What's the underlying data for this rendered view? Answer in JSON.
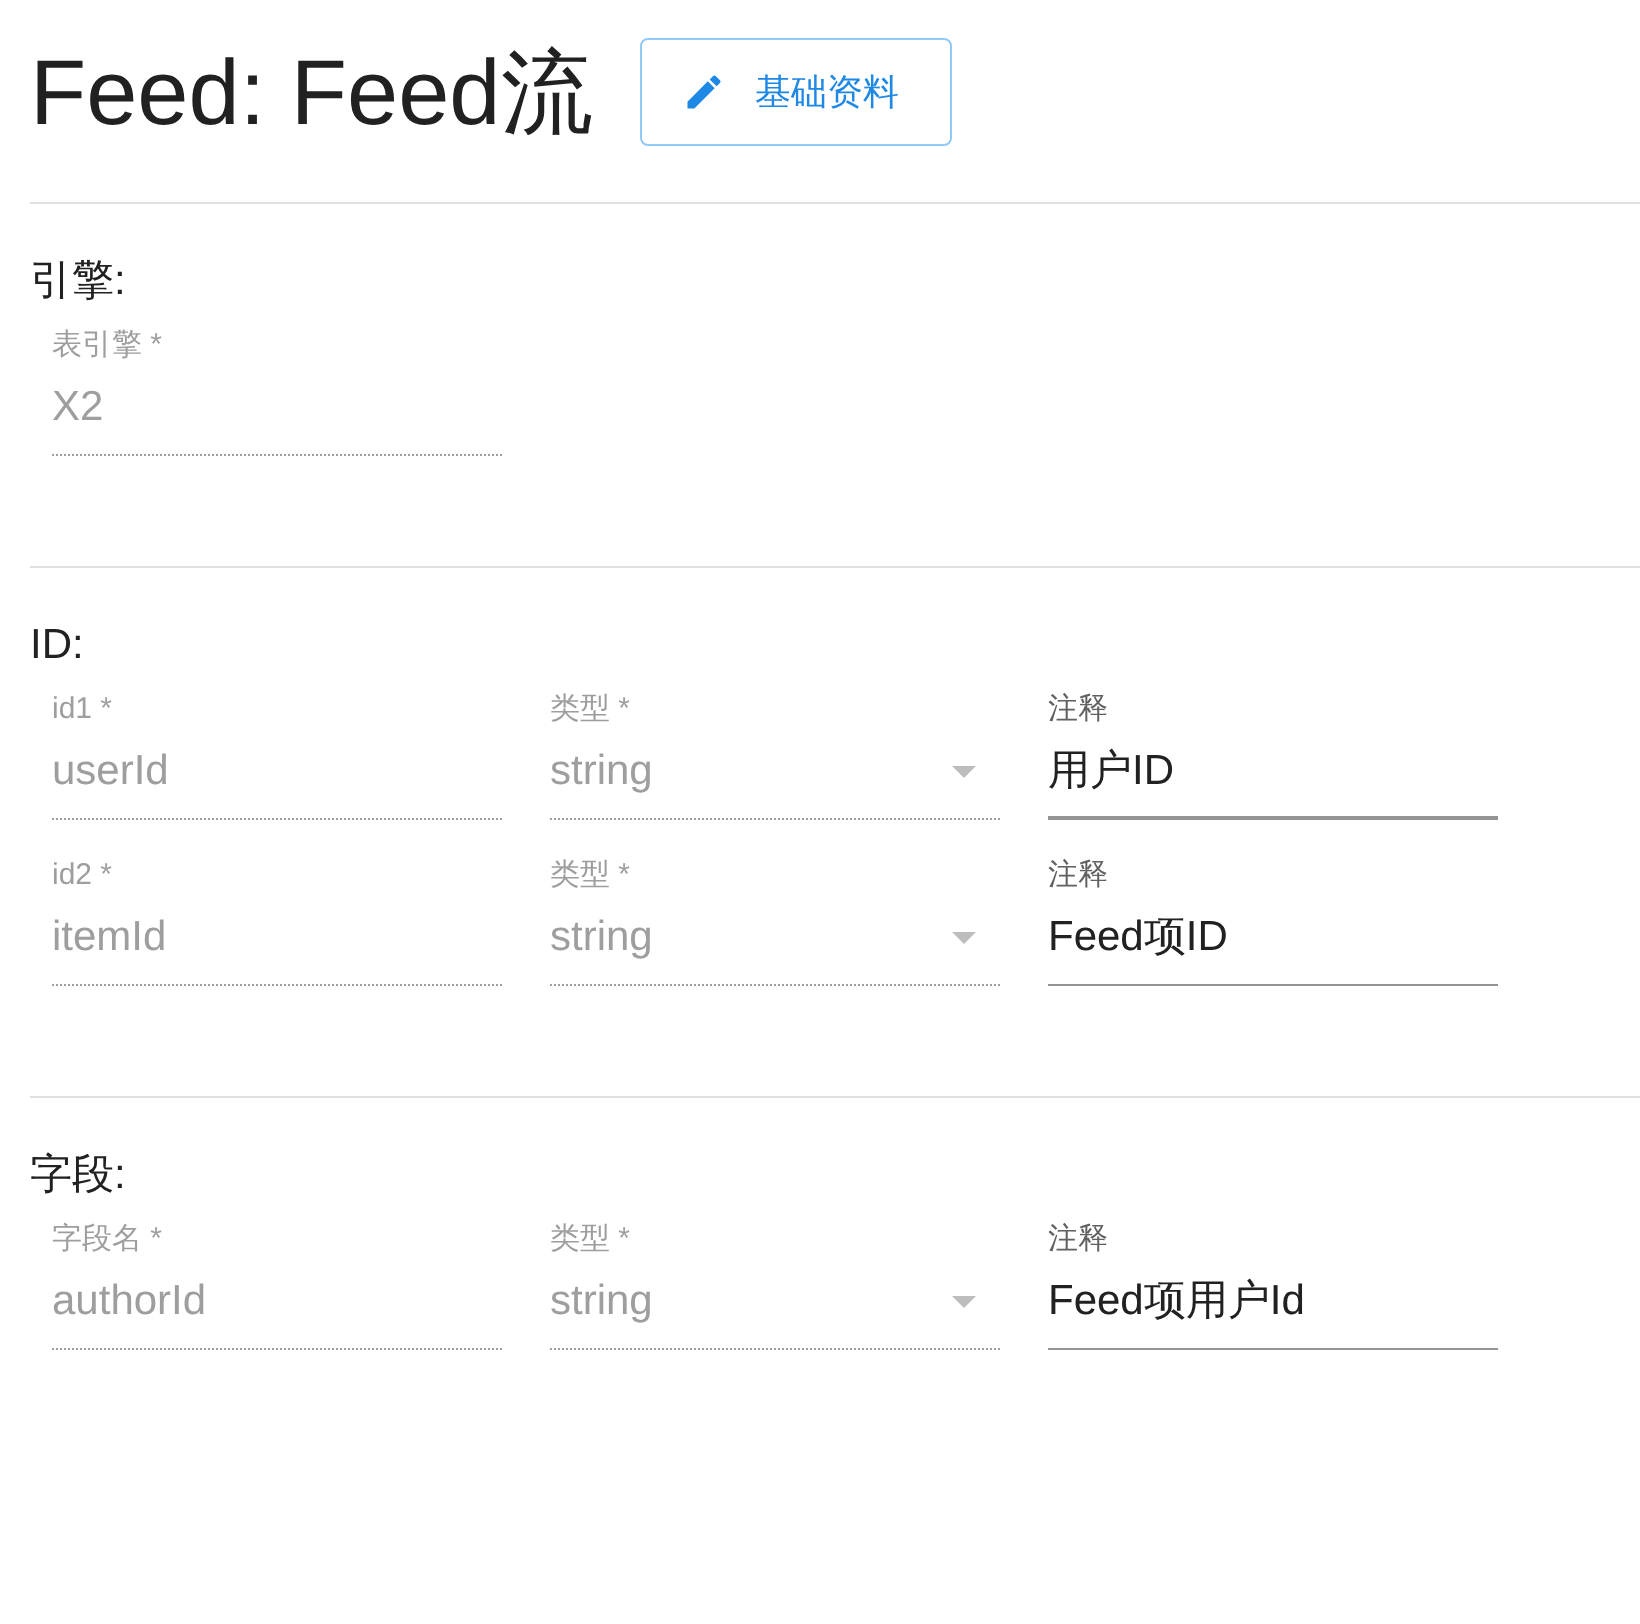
{
  "title": "Feed: Feed流",
  "edit_button": {
    "label": "基础资料"
  },
  "sections": [
    {
      "heading": "引擎:",
      "rows": [
        [
          {
            "kind": "text",
            "label": "表引擎 *",
            "value": "X2",
            "disabled": true,
            "active": false
          }
        ]
      ]
    },
    {
      "heading": "ID:",
      "rows": [
        [
          {
            "kind": "text",
            "label": "id1 *",
            "value": "userId",
            "disabled": true,
            "active": false
          },
          {
            "kind": "select",
            "label": "类型 *",
            "value": "string",
            "disabled": true,
            "active": false
          },
          {
            "kind": "text",
            "label": "注释",
            "value": "用户ID",
            "disabled": false,
            "active": true
          }
        ],
        [
          {
            "kind": "text",
            "label": "id2 *",
            "value": "itemId",
            "disabled": true,
            "active": false
          },
          {
            "kind": "select",
            "label": "类型 *",
            "value": "string",
            "disabled": true,
            "active": false
          },
          {
            "kind": "text",
            "label": "注释",
            "value": "Feed项ID",
            "disabled": false,
            "active": false
          }
        ]
      ]
    },
    {
      "heading": "字段:",
      "rows": [
        [
          {
            "kind": "text",
            "label": "字段名 *",
            "value": "authorId",
            "disabled": true,
            "active": false
          },
          {
            "kind": "select",
            "label": "类型 *",
            "value": "string",
            "disabled": true,
            "active": false
          },
          {
            "kind": "text",
            "label": "注释",
            "value": "Feed项用户Id",
            "disabled": false,
            "active": false
          }
        ]
      ]
    }
  ]
}
